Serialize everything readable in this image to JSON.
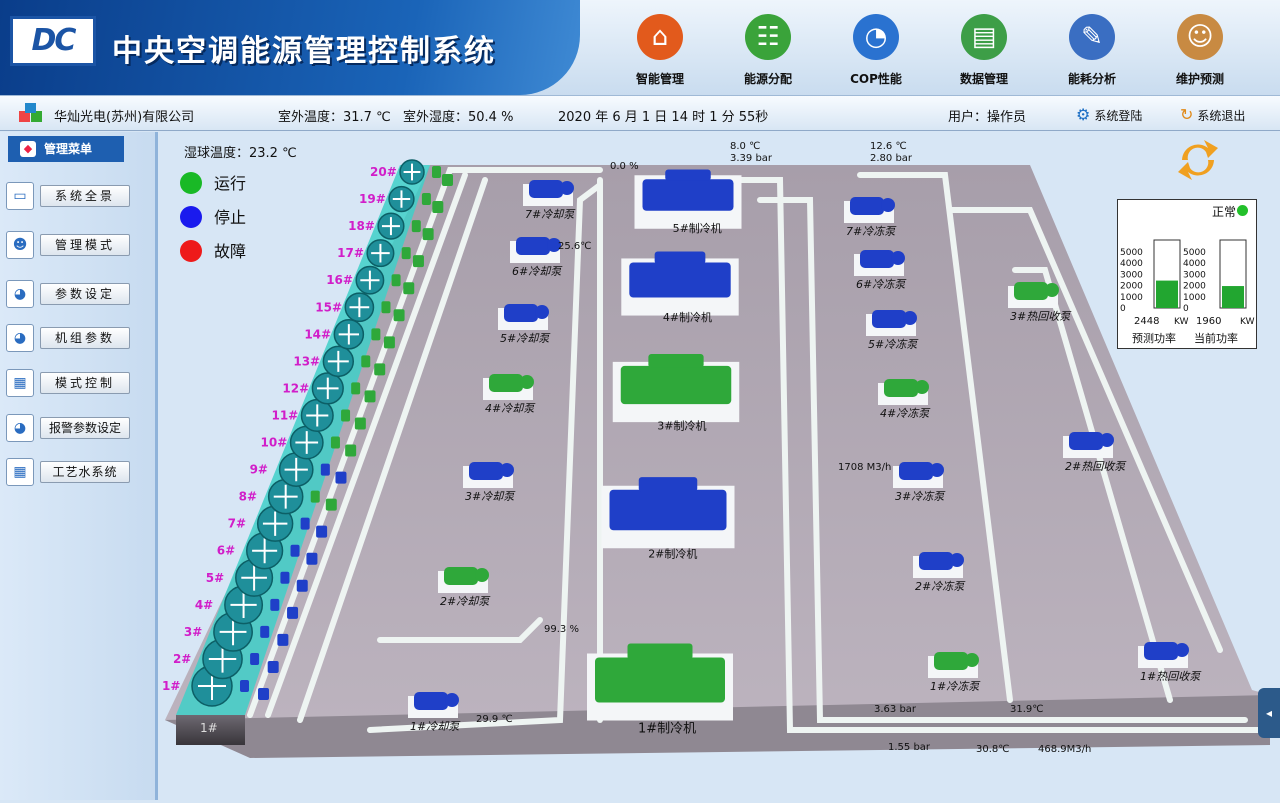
{
  "header": {
    "logo_text": "DC",
    "title": "中央空调能源管理控制系统",
    "nav": [
      {
        "label": "智能管理",
        "icon": "house-icon",
        "color": "#e25a1c"
      },
      {
        "label": "能源分配",
        "icon": "energy-distribution-icon",
        "color": "#3aa33a"
      },
      {
        "label": "COP性能",
        "icon": "gauge-icon",
        "color": "#2a72d0"
      },
      {
        "label": "数据管理",
        "icon": "folder-globe-icon",
        "color": "#3d9e47"
      },
      {
        "label": "能耗分析",
        "icon": "notebook-pen-icon",
        "color": "#3a6ec2"
      },
      {
        "label": "维护预测",
        "icon": "doctor-icon",
        "color": "#c88a42"
      }
    ]
  },
  "infobar": {
    "company": "华灿光电(苏州)有限公司",
    "outdoor_temp": "室外温度：31.7 ℃",
    "outdoor_humidity": "室外湿度：50.4 %",
    "datetime": "2020  年  6  月  1 日  14 时  1 分  55秒",
    "user": "用户：操作员",
    "login": "系统登陆",
    "logout": "系统退出"
  },
  "sidebar": {
    "title": "管理菜单",
    "items": [
      {
        "label": "系统全景",
        "icon": "monitor-icon"
      },
      {
        "label": "管理模式",
        "icon": "people-icon"
      },
      {
        "label": "参数设定",
        "icon": "dial-icon"
      },
      {
        "label": "机组参数",
        "icon": "dial-icon"
      },
      {
        "label": "模式控制",
        "icon": "chart-icon"
      },
      {
        "label": "报警参数设定",
        "icon": "dial-icon"
      },
      {
        "label": "工艺水系统",
        "icon": "chart-icon"
      }
    ]
  },
  "scene": {
    "wet_bulb": "湿球温度：23.2 ℃",
    "legend": [
      {
        "label": "运行",
        "color": "#19b926"
      },
      {
        "label": "停止",
        "color": "#1a1aee"
      },
      {
        "label": "故障",
        "color": "#ee1a1a"
      }
    ],
    "colors": {
      "running": "#2fa83a",
      "stopped": "#1f3fc8",
      "pipe": "#eef4f2",
      "floor": "#b4abb6",
      "tower": "#3fcfc8",
      "label": "#d11ec9"
    },
    "towers": [
      {
        "label": "1#",
        "status": "stopped"
      },
      {
        "label": "2#",
        "status": "stopped"
      },
      {
        "label": "3#",
        "status": "stopped"
      },
      {
        "label": "4#",
        "status": "stopped"
      },
      {
        "label": "5#",
        "status": "stopped"
      },
      {
        "label": "6#",
        "status": "stopped"
      },
      {
        "label": "7#",
        "status": "stopped"
      },
      {
        "label": "8#",
        "status": "running"
      },
      {
        "label": "9#",
        "status": "stopped"
      },
      {
        "label": "10#",
        "status": "running"
      },
      {
        "label": "11#",
        "status": "running"
      },
      {
        "label": "12#",
        "status": "running"
      },
      {
        "label": "13#",
        "status": "running"
      },
      {
        "label": "14#",
        "status": "running"
      },
      {
        "label": "15#",
        "status": "running"
      },
      {
        "label": "16#",
        "status": "running"
      },
      {
        "label": "17#",
        "status": "running"
      },
      {
        "label": "18#",
        "status": "running"
      },
      {
        "label": "19#",
        "status": "running"
      },
      {
        "label": "20#",
        "status": "running"
      }
    ],
    "tower_base_label": "1#",
    "chillers": [
      {
        "label": "1#制冷机",
        "status": "running"
      },
      {
        "label": "2#制冷机",
        "status": "stopped"
      },
      {
        "label": "3#制冷机",
        "status": "running"
      },
      {
        "label": "4#制冷机",
        "status": "stopped"
      },
      {
        "label": "5#制冷机",
        "status": "stopped"
      }
    ],
    "cooling_pumps": [
      {
        "label": "1#冷却泵",
        "status": "stopped"
      },
      {
        "label": "2#冷却泵",
        "status": "running"
      },
      {
        "label": "3#冷却泵",
        "status": "stopped"
      },
      {
        "label": "4#冷却泵",
        "status": "running"
      },
      {
        "label": "5#冷却泵",
        "status": "stopped"
      },
      {
        "label": "6#冷却泵",
        "status": "stopped"
      },
      {
        "label": "7#冷却泵",
        "status": "stopped"
      }
    ],
    "chilled_pumps": [
      {
        "label": "1#冷冻泵",
        "status": "running"
      },
      {
        "label": "2#冷冻泵",
        "status": "stopped"
      },
      {
        "label": "3#冷冻泵",
        "status": "stopped"
      },
      {
        "label": "4#冷冻泵",
        "status": "running"
      },
      {
        "label": "5#冷冻泵",
        "status": "stopped"
      },
      {
        "label": "6#冷冻泵",
        "status": "stopped"
      },
      {
        "label": "7#冷冻泵",
        "status": "stopped"
      }
    ],
    "recovery_pumps": [
      {
        "label": "1#热回收泵",
        "status": "stopped"
      },
      {
        "label": "2#热回收泵",
        "status": "stopped"
      },
      {
        "label": "3#热回收泵",
        "status": "running"
      }
    ],
    "readings": {
      "valve_top": "0.0  %",
      "temp_top_supply": "8.0  ℃",
      "pressure_top_supply": "3.39  bar",
      "temp_top_return": "12.6 ℃",
      "pressure_top_return": "2.80  bar",
      "temp_cooling_return": "25.6℃",
      "valve_bottom": "99.3 %",
      "temp_cooling_supply": "29.9 ℃",
      "flow_chilled": "1708 M3/h",
      "pressure_bottom_a": "3.63  bar",
      "temp_bottom_a": "31.9℃",
      "pressure_bottom_b": "1.55  bar",
      "temp_bottom_b": "30.8℃",
      "flow_bottom": "468.9M3/h"
    }
  },
  "status_box": {
    "status": "正常",
    "status_color": "#22c02a",
    "ticks": [
      "5000",
      "4000",
      "3000",
      "2000",
      "1000",
      "0"
    ],
    "gauges": [
      {
        "value": 2448,
        "value_text": "2448",
        "unit": "KW",
        "label": "预测功率"
      },
      {
        "value": 1960,
        "value_text": "1960",
        "unit": "KW",
        "label": "当前功率"
      }
    ],
    "max": 5000
  }
}
